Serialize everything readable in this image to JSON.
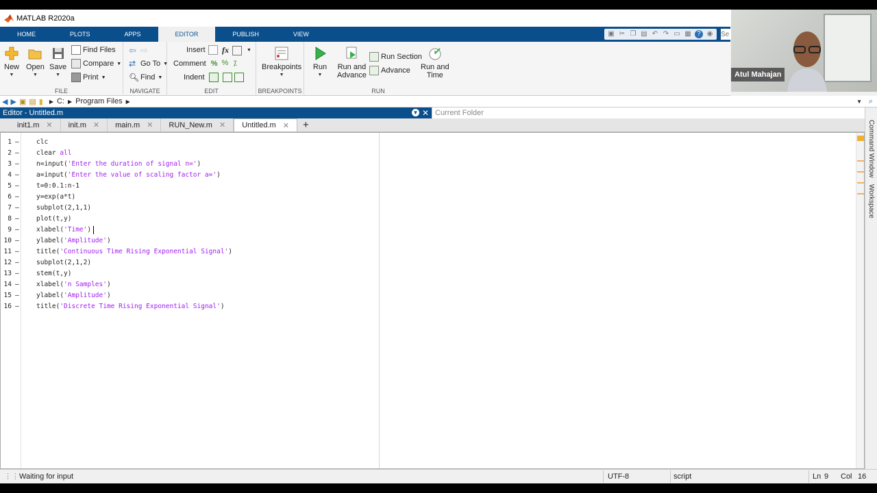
{
  "window": {
    "title": "MATLAB R2020a"
  },
  "ribbon_tabs": [
    {
      "label": "HOME",
      "active": false
    },
    {
      "label": "PLOTS",
      "active": false
    },
    {
      "label": "APPS",
      "active": false
    },
    {
      "label": "EDITOR",
      "active": true
    },
    {
      "label": "PUBLISH",
      "active": false
    },
    {
      "label": "VIEW",
      "active": false
    }
  ],
  "search": {
    "placeholder": "Se"
  },
  "ribbon": {
    "file": {
      "label": "FILE",
      "new": "New",
      "open": "Open",
      "save": "Save",
      "find_files": "Find Files",
      "compare": "Compare",
      "print": "Print"
    },
    "navigate": {
      "label": "NAVIGATE",
      "go_to": "Go To",
      "find": "Find"
    },
    "edit": {
      "label": "EDIT",
      "insert": "Insert",
      "comment": "Comment",
      "indent": "Indent",
      "fx": "fx"
    },
    "breakpoints": {
      "label": "BREAKPOINTS",
      "breakpoints": "Breakpoints"
    },
    "run": {
      "label": "RUN",
      "run": "Run",
      "run_and_advance_1": "Run and",
      "run_and_advance_2": "Advance",
      "run_section": "Run Section",
      "advance": "Advance",
      "run_and_time_1": "Run and",
      "run_and_time_2": "Time"
    }
  },
  "webcam": {
    "name": "Atul Mahajan"
  },
  "address": {
    "drive": "C:",
    "folder": "Program Files"
  },
  "editor": {
    "title": "Editor - Untitled.m"
  },
  "current_folder": {
    "label": "Current Folder"
  },
  "side_panels": {
    "command_window": "Command Window",
    "workspace": "Workspace"
  },
  "tabs": [
    {
      "label": "init1.m",
      "active": false
    },
    {
      "label": "init.m",
      "active": false
    },
    {
      "label": "main.m",
      "active": false
    },
    {
      "label": "RUN_New.m",
      "active": false
    },
    {
      "label": "Untitled.m",
      "active": true
    }
  ],
  "code": [
    {
      "n": "1",
      "plain": "clc",
      "str": ""
    },
    {
      "n": "2",
      "plain": "clear ",
      "str": "all"
    },
    {
      "n": "3",
      "plain": "n=input(",
      "str": "'Enter the duration of signal n='",
      "tail": ")"
    },
    {
      "n": "4",
      "plain": "a=input(",
      "str": "'Enter the value of scaling factor a='",
      "tail": ")"
    },
    {
      "n": "5",
      "plain": "t=0:0.1:n-1",
      "str": ""
    },
    {
      "n": "6",
      "plain": "y=exp(a*t)",
      "str": ""
    },
    {
      "n": "7",
      "plain": "subplot(2,1,1)",
      "str": ""
    },
    {
      "n": "8",
      "plain": "plot(t,y)",
      "str": ""
    },
    {
      "n": "9",
      "plain": "xlabel(",
      "str": "'Time'",
      "tail": ")"
    },
    {
      "n": "10",
      "plain": "ylabel(",
      "str": "'Amplitude'",
      "tail": ")"
    },
    {
      "n": "11",
      "plain": "title(",
      "str": "'Continuous Time Rising Exponential Signal'",
      "tail": ")"
    },
    {
      "n": "12",
      "plain": "subplot(2,1,2)",
      "str": ""
    },
    {
      "n": "13",
      "plain": "stem(t,y)",
      "str": ""
    },
    {
      "n": "14",
      "plain": "xlabel(",
      "str": "'n Samples'",
      "tail": ")"
    },
    {
      "n": "15",
      "plain": "ylabel(",
      "str": "'Amplitude'",
      "tail": ")"
    },
    {
      "n": "16",
      "plain": "title(",
      "str": "'Discrete Time Rising Exponential Signal'",
      "tail": ")"
    }
  ],
  "status": {
    "message": "Waiting for input",
    "encoding": "UTF-8",
    "type": "script",
    "ln_label": "Ln",
    "ln": "9",
    "col_label": "Col",
    "col": "16"
  }
}
